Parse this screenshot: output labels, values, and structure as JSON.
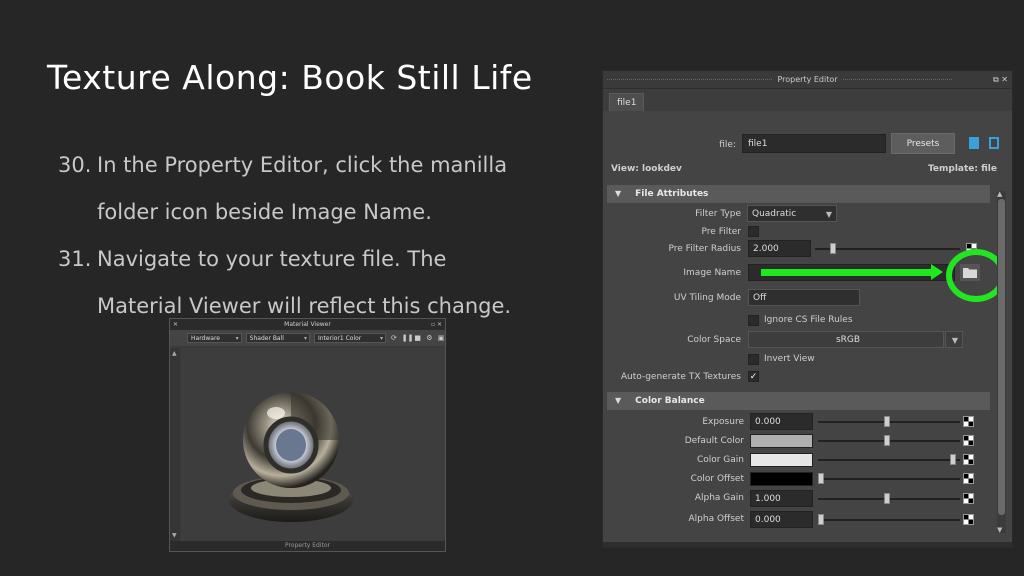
{
  "slide": {
    "title": "Texture Along: Book Still Life",
    "steps": [
      {
        "num": "30.",
        "line1": "In the Property Editor, click the manilla",
        "line2": "folder icon beside Image Name."
      },
      {
        "num": "31.",
        "line1": "Navigate to your texture file. The",
        "line2": "Material Viewer will reflect this change."
      }
    ]
  },
  "material_viewer": {
    "title": "Material Viewer",
    "renderer": "Hardware",
    "shader_ball": "Shader Ball",
    "environment": "Interior1 Color",
    "bottom_label": "Property Editor"
  },
  "property_editor": {
    "window_title": "Property Editor",
    "tab": "file1",
    "file_label": "file:",
    "file_value": "file1",
    "presets_label": "Presets",
    "view_label": "View: lookdev",
    "template_label": "Template: file",
    "sections": {
      "file_attributes": "File Attributes",
      "color_balance": "Color Balance"
    },
    "file_attributes": {
      "filter_type_label": "Filter Type",
      "filter_type_value": "Quadratic",
      "pre_filter_label": "Pre Filter",
      "pre_filter_radius_label": "Pre Filter Radius",
      "pre_filter_radius_value": "2.000",
      "image_name_label": "Image Name",
      "uv_tiling_label": "UV Tiling Mode",
      "uv_tiling_value": "Off",
      "ignore_cs_label": "Ignore CS File Rules",
      "color_space_label": "Color Space",
      "color_space_value": "sRGB",
      "invert_view_label": "Invert View",
      "auto_tx_label": "Auto-generate TX Textures",
      "auto_tx_check": "✓"
    },
    "color_balance": {
      "exposure_label": "Exposure",
      "exposure_value": "0.000",
      "default_color_label": "Default Color",
      "color_gain_label": "Color Gain",
      "color_offset_label": "Color Offset",
      "alpha_gain_label": "Alpha Gain",
      "alpha_gain_value": "1.000",
      "alpha_offset_label": "Alpha Offset",
      "alpha_offset_value": "0.000"
    }
  }
}
